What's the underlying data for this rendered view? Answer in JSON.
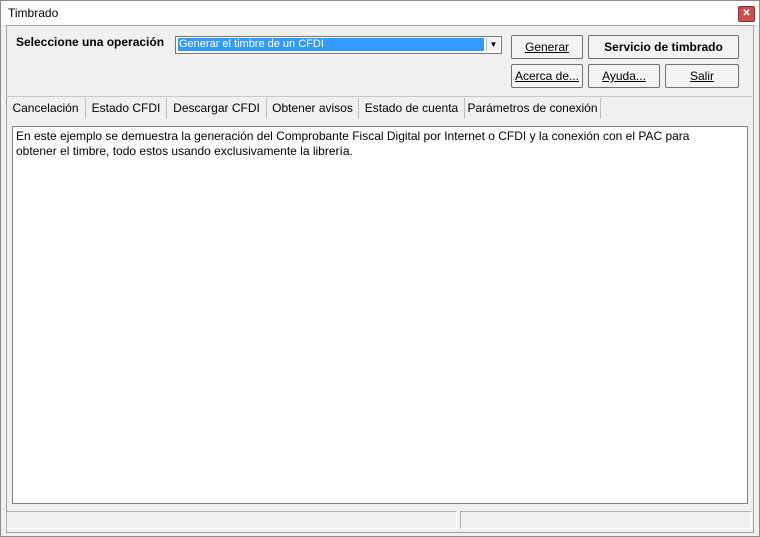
{
  "window": {
    "title": "Timbrado",
    "close_glyph": "✕"
  },
  "operation": {
    "label": "Seleccione una operación",
    "selected": "Generar el timbre de un CFDI",
    "arrow_glyph": "▼"
  },
  "buttons": {
    "generar": "Generar",
    "servicio": "Servicio de timbrado",
    "acerca": "Acerca de...",
    "ayuda": "Ayuda...",
    "salir": "Salir"
  },
  "tabs": [
    "Cancelación",
    "Estado CFDI",
    "Descargar CFDI",
    "Obtener avisos",
    "Estado de cuenta",
    "Parámetros de conexión"
  ],
  "content": {
    "text": "En este ejemplo se demuestra la generación del Comprobante Fiscal Digital por Internet o CFDI y la conexión con el PAC para obtener el timbre, todo estos usando exclusivamente la librería."
  },
  "status": {
    "left": "",
    "right": ""
  },
  "colors": {
    "selection": "#3399ff",
    "close": "#c75050"
  }
}
